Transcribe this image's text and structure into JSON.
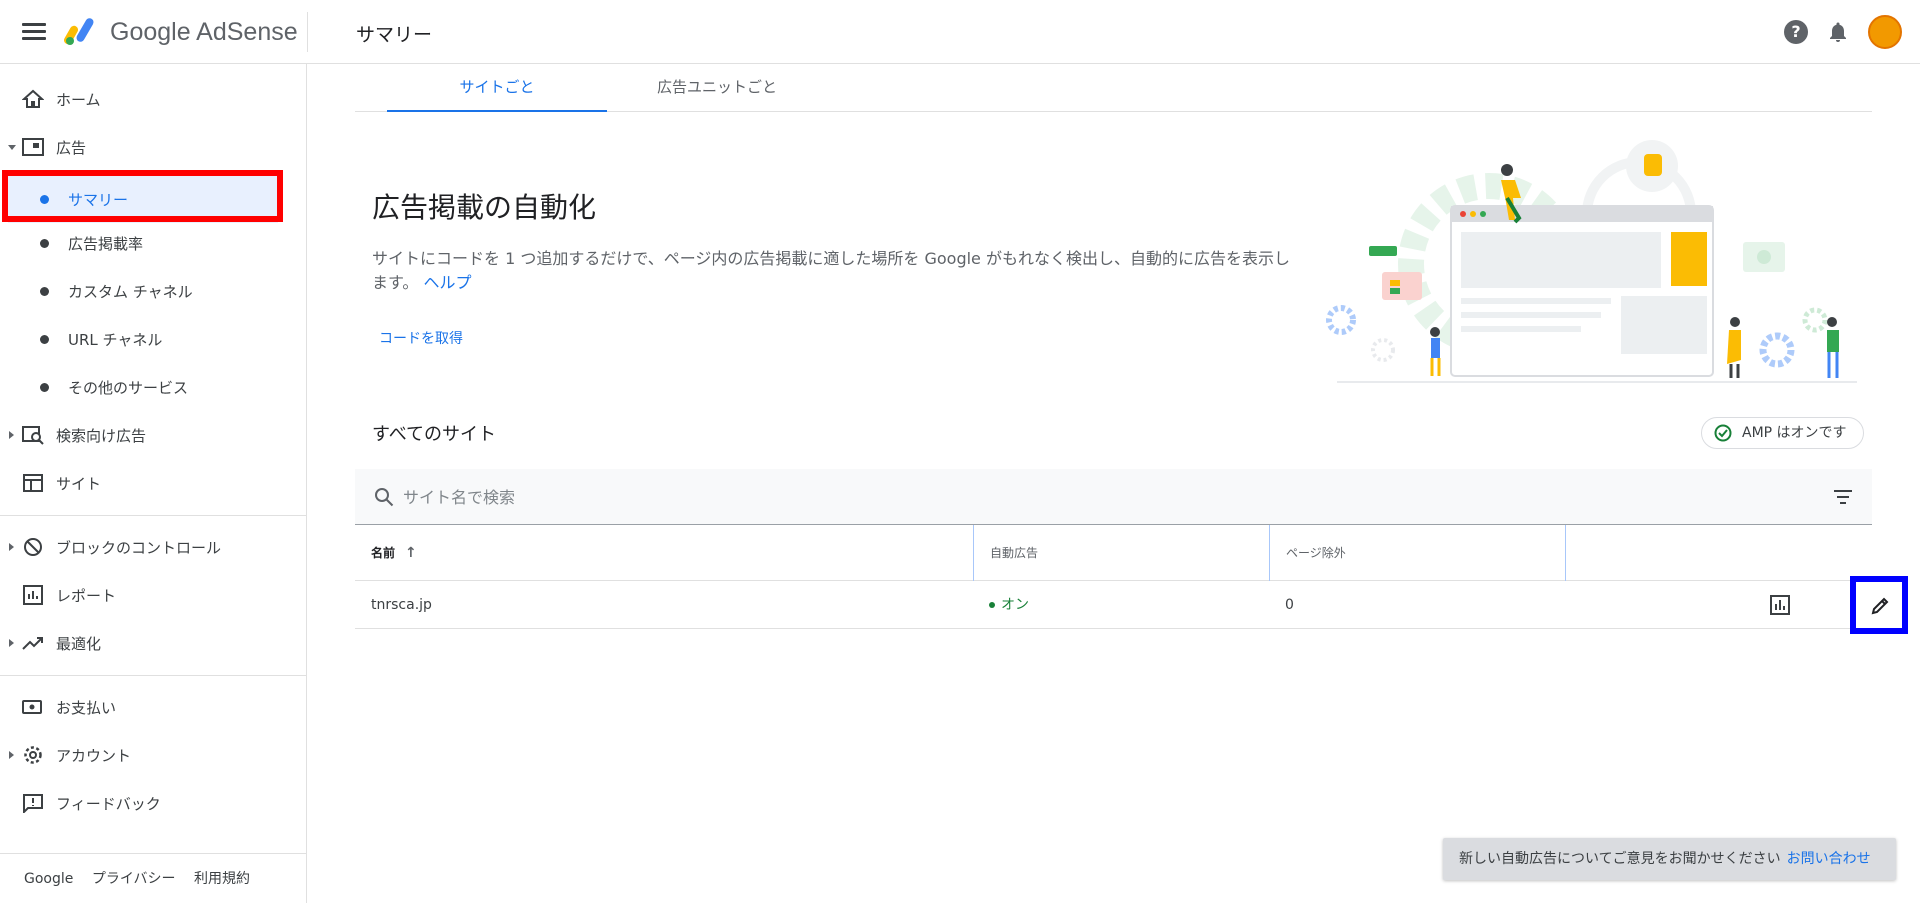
{
  "header": {
    "brand": "Google AdSense",
    "page_title": "サマリー",
    "icons": [
      "menu-icon",
      "adsense-logo",
      "help-icon",
      "bell-icon",
      "avatar"
    ]
  },
  "sidebar": {
    "items": [
      {
        "label": "ホーム",
        "icon": "home-icon"
      },
      {
        "label": "広告",
        "icon": "ads-icon",
        "expanded": true
      },
      {
        "label": "サマリー",
        "sub": true,
        "active": true
      },
      {
        "label": "広告掲載率",
        "sub": true
      },
      {
        "label": "カスタム チャネル",
        "sub": true
      },
      {
        "label": "URL チャネル",
        "sub": true
      },
      {
        "label": "その他のサービス",
        "sub": true
      },
      {
        "label": "検索向け広告",
        "icon": "search-ads-icon"
      },
      {
        "label": "サイト",
        "icon": "site-icon"
      },
      {
        "label": "ブロックのコントロール",
        "icon": "block-icon"
      },
      {
        "label": "レポート",
        "icon": "report-icon"
      },
      {
        "label": "最適化",
        "icon": "trending-icon"
      },
      {
        "label": "お支払い",
        "icon": "payment-icon"
      },
      {
        "label": "アカウント",
        "icon": "gear-icon"
      },
      {
        "label": "フィードバック",
        "icon": "feedback-icon"
      }
    ],
    "footer": {
      "google": "Google",
      "privacy": "プライバシー",
      "terms": "利用規約"
    }
  },
  "main": {
    "tabs": [
      {
        "label": "サイトごと",
        "active": true
      },
      {
        "label": "広告ユニットごと"
      }
    ],
    "hero": {
      "title": "広告掲載の自動化",
      "description": "サイトにコードを 1 つ追加するだけで、ページ内の広告掲載に適した場所を Google がもれなく検出し、自動的に広告を表示します。",
      "help_link": "ヘルプ",
      "get_code": "コードを取得"
    },
    "sites": {
      "heading": "すべてのサイト",
      "amp_badge": "AMP はオンです",
      "search_placeholder": "サイト名で検索",
      "columns": [
        "名前",
        "自動広告",
        "ページ除外"
      ],
      "rows": [
        {
          "name": "tnrsca.jp",
          "auto_ads": "オン",
          "page_exclusions": "0"
        }
      ]
    }
  },
  "snackbar": {
    "text": "新しい自動広告についてご意見をお聞かせください",
    "link": "お問い合わせ"
  },
  "colors": {
    "accent": "#1a73e8",
    "success": "#188038",
    "highlight_red": "#ff0000",
    "highlight_blue": "#0000ff"
  }
}
